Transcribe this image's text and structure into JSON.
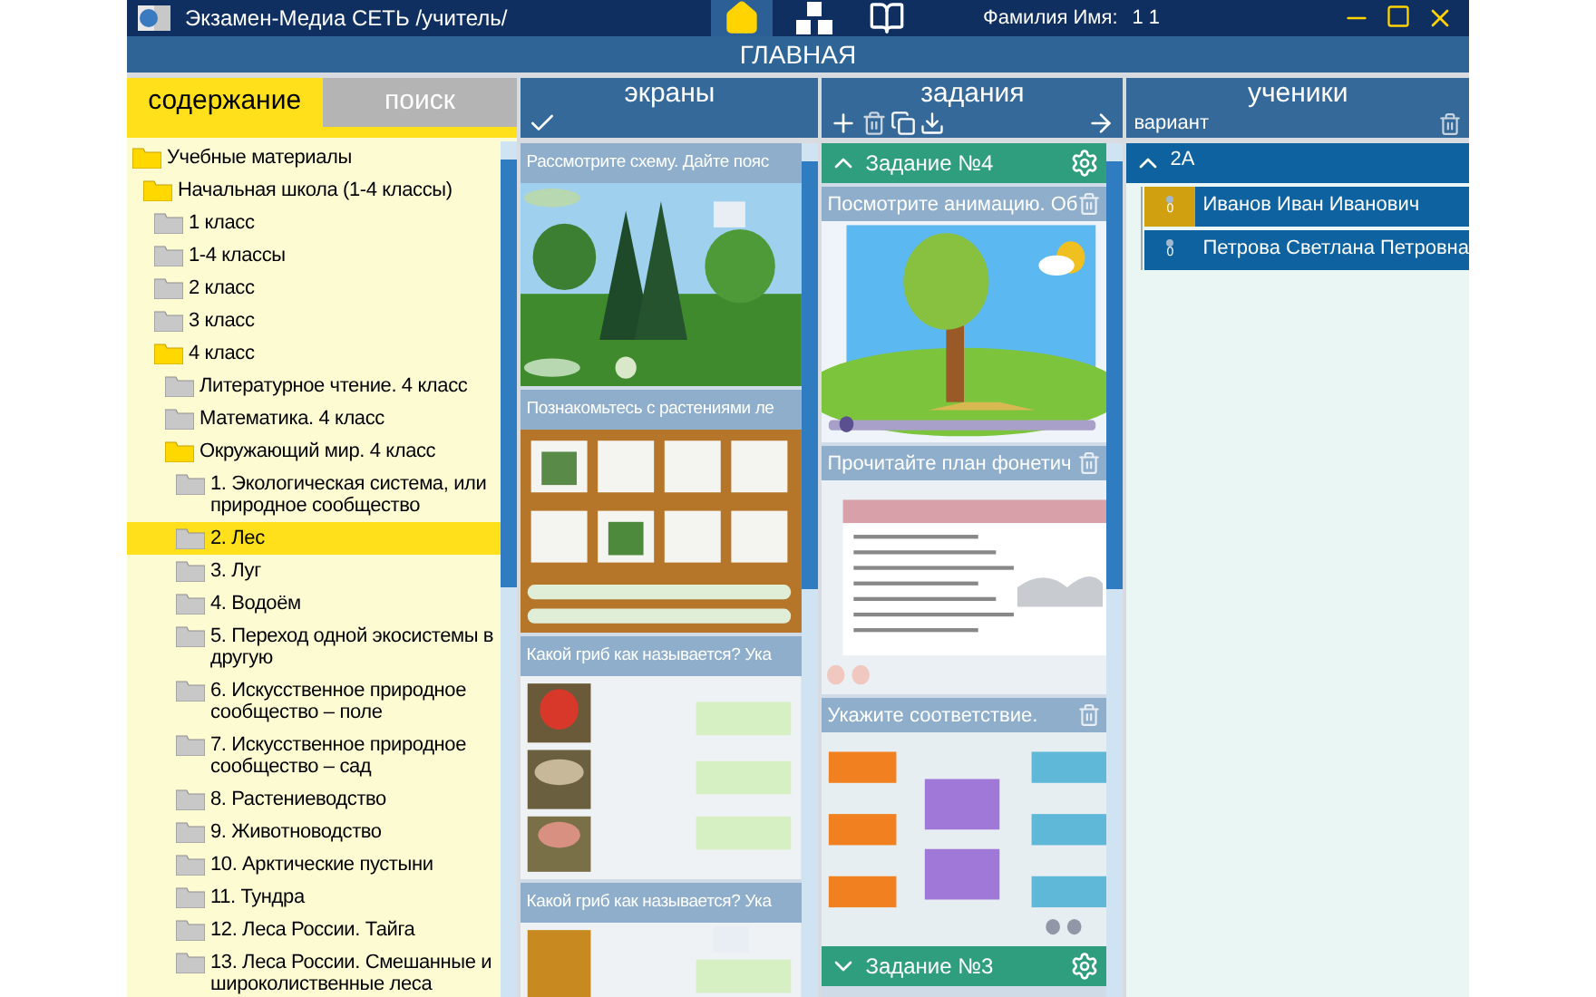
{
  "window": {
    "title": "Экзамен-Медиа СЕТЬ /учитель/",
    "user_label": "Фамилия Имя:",
    "user_value": "1 1"
  },
  "nav": [
    {
      "kind": "home",
      "selected": true
    },
    {
      "kind": "blocks",
      "selected": false
    },
    {
      "kind": "book",
      "selected": false
    }
  ],
  "page_title": "ГЛАВНАЯ",
  "left_tabs": [
    {
      "label": "содержание",
      "selected": true
    },
    {
      "label": "поиск",
      "selected": false
    }
  ],
  "tree": [
    {
      "label": "Учебные материалы",
      "expanded": true,
      "selected": false,
      "children": [
        {
          "label": "Начальная школа (1-4 классы)",
          "expanded": true,
          "selected": false,
          "children": [
            {
              "label": "1 класс",
              "expanded": false,
              "selected": false
            },
            {
              "label": "1-4 классы",
              "expanded": false,
              "selected": false
            },
            {
              "label": "2 класс",
              "expanded": false,
              "selected": false
            },
            {
              "label": "3 класс",
              "expanded": false,
              "selected": false
            },
            {
              "label": "4 класс",
              "expanded": true,
              "selected": false,
              "children": [
                {
                  "label": "Литературное чтение. 4 класс",
                  "expanded": false,
                  "selected": false
                },
                {
                  "label": "Математика. 4 класс",
                  "expanded": false,
                  "selected": false
                },
                {
                  "label": "Окружающий мир. 4 класс",
                  "expanded": true,
                  "selected": false,
                  "children": [
                    {
                      "label": "1. Экологическая система, или природное сообщество",
                      "expanded": false,
                      "selected": false
                    },
                    {
                      "label": "2. Лес",
                      "expanded": false,
                      "selected": true
                    },
                    {
                      "label": "3. Луг",
                      "expanded": false,
                      "selected": false
                    },
                    {
                      "label": "4. Водоём",
                      "expanded": false,
                      "selected": false
                    },
                    {
                      "label": "5. Переход одной экосистемы в другую",
                      "expanded": false,
                      "selected": false
                    },
                    {
                      "label": "6. Искусственное природное сообщество – поле",
                      "expanded": false,
                      "selected": false
                    },
                    {
                      "label": "7. Искусственное природное сообщество – сад",
                      "expanded": false,
                      "selected": false
                    },
                    {
                      "label": "8. Растениеводство",
                      "expanded": false,
                      "selected": false
                    },
                    {
                      "label": "9. Животноводство",
                      "expanded": false,
                      "selected": false
                    },
                    {
                      "label": "10. Арктические пустыни",
                      "expanded": false,
                      "selected": false
                    },
                    {
                      "label": "11. Тундра",
                      "expanded": false,
                      "selected": false
                    },
                    {
                      "label": "12. Леса России. Тайга",
                      "expanded": false,
                      "selected": false
                    },
                    {
                      "label": "13. Леса России. Смешанные и широколиственные леса",
                      "expanded": false,
                      "selected": false
                    }
                  ]
                }
              ]
            }
          ]
        }
      ]
    }
  ],
  "screens": {
    "title": "экраны",
    "items": [
      {
        "caption": "Рассмотрите схему. Дайте пояс"
      },
      {
        "caption": "Познакомьтесь с растениями ле"
      },
      {
        "caption": "Какой гриб как называется? Ука"
      },
      {
        "caption": "Какой гриб как называется? Ука"
      }
    ]
  },
  "tasks": {
    "title": "задания",
    "groups": [
      {
        "label": "Задание №4",
        "expanded": true,
        "items": [
          {
            "caption": "Посмотрите анимацию. Об"
          },
          {
            "caption": "Прочитайте план фонетич"
          },
          {
            "caption": "Укажите соответствие."
          }
        ]
      },
      {
        "label": "Задание №3",
        "expanded": false
      }
    ]
  },
  "students": {
    "title": "ученики",
    "variant_label": "вариант",
    "groups": [
      {
        "label": "2А",
        "expanded": true,
        "students": [
          {
            "name": "Иванов Иван Иванович",
            "count": "0",
            "selected": true
          },
          {
            "name": "Петрова Светлана Петровна",
            "count": "0",
            "selected": false
          }
        ]
      }
    ]
  }
}
